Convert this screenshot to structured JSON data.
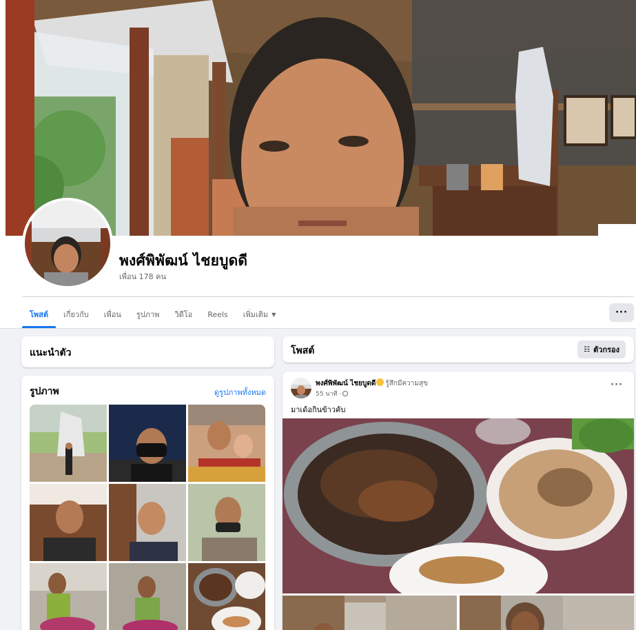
{
  "profile": {
    "name": "พงศ์พิพัฒน์ ไชยบูดดี",
    "friends": "เพื่อน 178 คน"
  },
  "tabs": [
    {
      "label": "โพสต์",
      "active": true
    },
    {
      "label": "เกี่ยวกับ"
    },
    {
      "label": "เพื่อน"
    },
    {
      "label": "รูปภาพ"
    },
    {
      "label": "วิดีโอ"
    },
    {
      "label": "Reels"
    },
    {
      "label": "เพิ่มเติม",
      "caret": "▼"
    }
  ],
  "more_button": "···",
  "intro": {
    "title": "แนะนำตัว"
  },
  "photos": {
    "title": "รูปภาพ",
    "see_all": "ดูรูปภาพทั้งหมด",
    "count": 9
  },
  "posts_section": {
    "title": "โพสต์",
    "filter_label": "ตัวกรอง"
  },
  "post": {
    "author": "พงศ์พิพัฒน์ ไชยบูดดี",
    "feeling": "รู้สึกมีความสุข",
    "time": "55 นาที ·",
    "text": "มาเด้อกินข้าวคับ",
    "menu": "···"
  },
  "colors": {
    "accent": "#1877f2",
    "background": "#f0f2f5",
    "secondary_text": "#65676b"
  }
}
